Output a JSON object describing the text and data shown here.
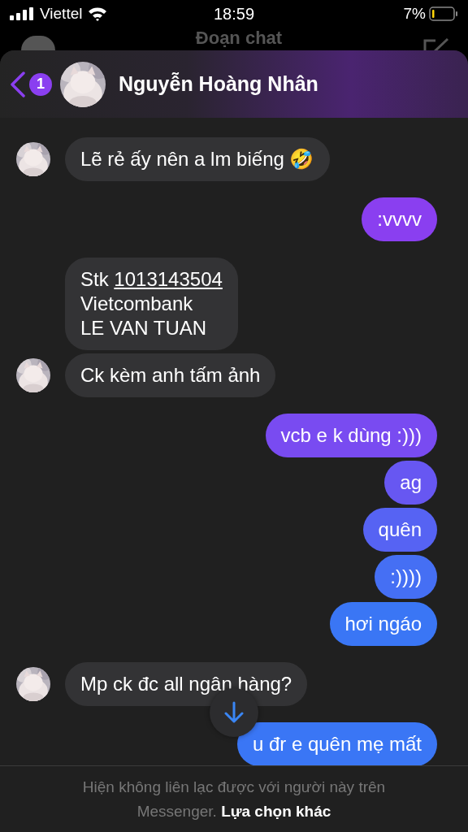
{
  "status_bar": {
    "carrier": "Viettel",
    "time": "18:59",
    "battery": "7%"
  },
  "background_screen": {
    "title": "Đoạn chat"
  },
  "chat_header": {
    "unread_badge": "1",
    "name": "Nguyễn Hoàng Nhân"
  },
  "messages": [
    {
      "kind": "incoming",
      "avatar": true,
      "lines": [
        "Lẽ rẻ ấy nên a lm biếng 🤣"
      ]
    },
    {
      "kind": "outgoing",
      "lines": [
        ":vvvv"
      ]
    },
    {
      "kind": "incoming",
      "avatar": false,
      "lines": [
        "Stk **1013143504**",
        "Vietcombank",
        "LE VAN TUAN"
      ]
    },
    {
      "kind": "incoming",
      "avatar": true,
      "lines": [
        "Ck kèm anh tấm ảnh"
      ]
    },
    {
      "kind": "outgoing",
      "lines": [
        "vcb e k dùng :)))"
      ]
    },
    {
      "kind": "outgoing",
      "lines": [
        "ag"
      ]
    },
    {
      "kind": "outgoing",
      "lines": [
        "quên"
      ]
    },
    {
      "kind": "outgoing",
      "lines": [
        ":))))"
      ]
    },
    {
      "kind": "outgoing",
      "lines": [
        "hơi ngáo"
      ]
    },
    {
      "kind": "incoming",
      "avatar": true,
      "lines": [
        "Mp ck đc all ngân hàng?"
      ]
    },
    {
      "kind": "outgoing",
      "lines": [
        "u đr e quên mẹ mất"
      ]
    }
  ],
  "footer": {
    "notice": "Hiện không liên lạc được với người này trên Messenger.",
    "link": "Lựa chọn khác"
  }
}
